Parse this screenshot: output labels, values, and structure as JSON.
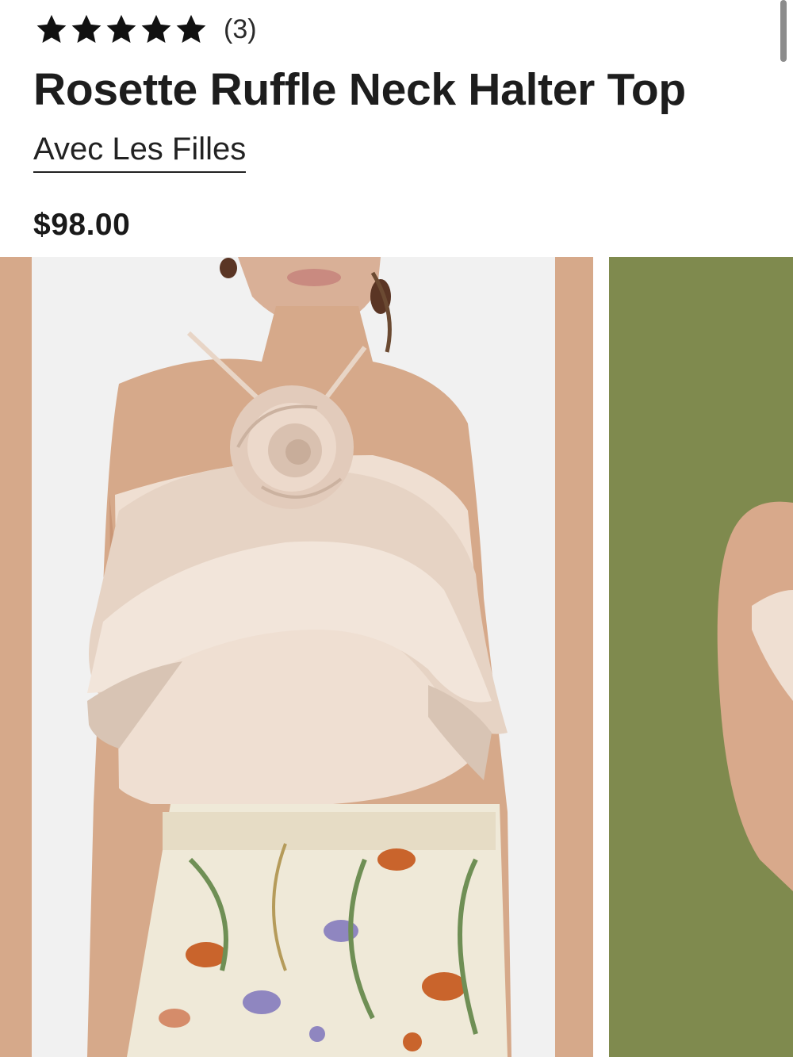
{
  "product": {
    "rating": {
      "stars": 5,
      "count_label": "(3)"
    },
    "title": "Rosette Ruffle Neck Halter Top",
    "brand": "Avec Les Filles",
    "price": "$98.00"
  },
  "gallery": {
    "images": [
      {
        "description_icon": "product-photo-front",
        "background": "#f1f1f1"
      },
      {
        "description_icon": "product-photo-alt",
        "background": "#7f8a4e"
      }
    ]
  },
  "colors": {
    "text": "#1a1a1a",
    "skin": "#d6a98a",
    "top": "#efdfd2",
    "ruffle_shadow": "#d8c4b4",
    "print_base": "#efe9d8",
    "olive": "#7f8a4e"
  }
}
